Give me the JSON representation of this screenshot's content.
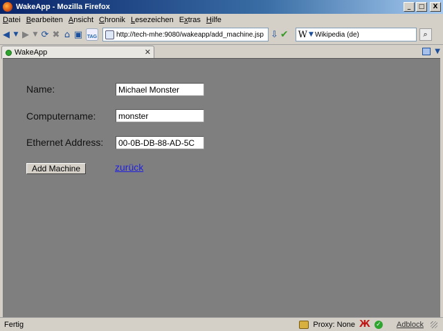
{
  "window": {
    "title": "WakeApp - Mozilla Firefox",
    "buttons": {
      "minimize": "_",
      "maximize": "□",
      "close": "X"
    }
  },
  "menu": [
    {
      "pre": "",
      "u": "D",
      "post": "atei"
    },
    {
      "pre": "",
      "u": "B",
      "post": "earbeiten"
    },
    {
      "pre": "",
      "u": "A",
      "post": "nsicht"
    },
    {
      "pre": "",
      "u": "C",
      "post": "hronik"
    },
    {
      "pre": "",
      "u": "L",
      "post": "esezeichen"
    },
    {
      "pre": "E",
      "u": "x",
      "post": "tras"
    },
    {
      "pre": "",
      "u": "H",
      "post": "ilfe"
    }
  ],
  "toolbar": {
    "url": "http://tech-mhe:9080/wakeapp/add_machine.jsp",
    "search_engine": "Wikipedia (de)",
    "search_engine_glyph": "W",
    "tag_label": "TAG"
  },
  "tab": {
    "title": "WakeApp",
    "close": "✕"
  },
  "form": {
    "name_label": "Name:",
    "name_value": "Michael Monster",
    "computer_label": "Computername:",
    "computer_value": "monster",
    "ethernet_label": "Ethernet Address:",
    "ethernet_value": "00-0B-DB-88-AD-5C",
    "submit_label": "Add Machine",
    "back_link": "zurück"
  },
  "status": {
    "text": "Fertig",
    "proxy": "Proxy: None",
    "adblock": "Adblock"
  },
  "colors": {
    "content_bg": "#7f7f7f",
    "link": "#2020e0"
  }
}
